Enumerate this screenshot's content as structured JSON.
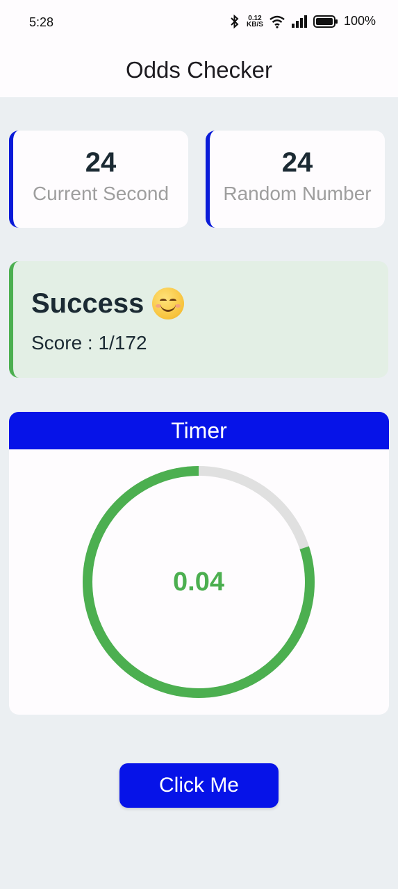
{
  "status_bar": {
    "time": "5:28",
    "net_speed_value": "0.12",
    "net_speed_unit": "KB/S",
    "battery": "100%"
  },
  "app_bar": {
    "title": "Odds Checker"
  },
  "stats": {
    "current_second": {
      "value": "24",
      "label": "Current Second"
    },
    "random_number": {
      "value": "24",
      "label": "Random Number"
    }
  },
  "result": {
    "title": "Success",
    "emoji": "smiling-face-icon",
    "score": "Score : 1/172"
  },
  "timer": {
    "header": "Timer",
    "value": "0.04",
    "progress_fraction": 0.8
  },
  "action": {
    "button_label": "Click Me"
  },
  "colors": {
    "accent": "#0613e8",
    "success": "#4caf50",
    "ring_track": "#e0e0e0",
    "background": "#ebeff2"
  }
}
